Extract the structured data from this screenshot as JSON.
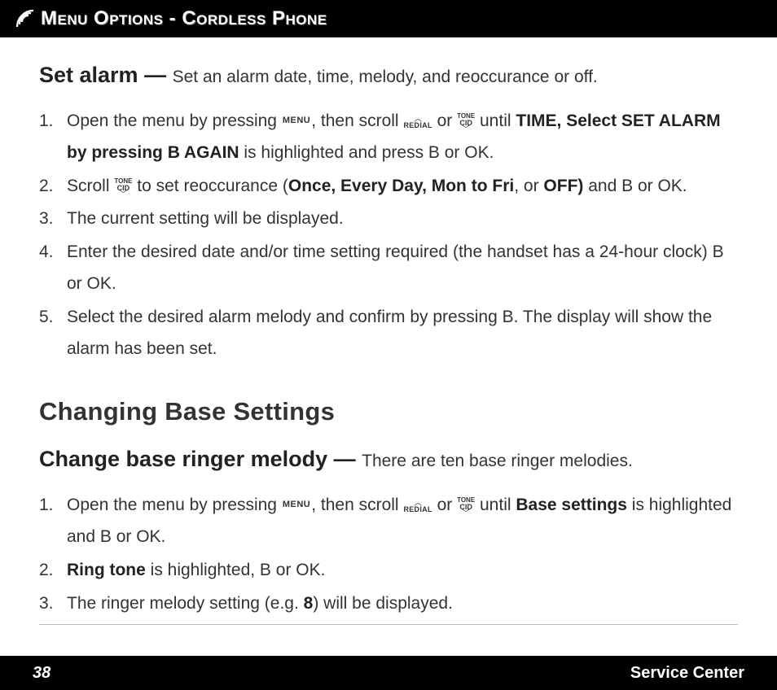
{
  "header": {
    "title": "Menu Options - Cordless Phone"
  },
  "icons": {
    "menu": "MENU",
    "redial": "REDIAL",
    "tone": "TONE",
    "cid": "CID"
  },
  "set_alarm": {
    "heading": "Set alarm",
    "dash": " — ",
    "desc": "Set an alarm date, time, melody, and reoccurance or off.",
    "steps": [
      {
        "n": "1.",
        "pre": "Open the menu by pressing ",
        "mid1": ", then scroll ",
        "mid2": " or ",
        "mid3": " until ",
        "bold1": "TIME, Select SET ALARM by pressing B AGAIN",
        "post": " is highlighted and press B or OK."
      },
      {
        "n": "2.",
        "pre": "Scroll ",
        "mid1": " to set reoccurance (",
        "bold1": "Once, Every Day, Mon to Fri",
        "mid2": ", or ",
        "bold2": "OFF)",
        "post": " and B or OK."
      },
      {
        "n": "3.",
        "text": "The current setting will be displayed."
      },
      {
        "n": "4.",
        "text": "Enter the desired date and/or time setting required (the handset has a 24-hour clock) B or OK."
      },
      {
        "n": "5.",
        "text": "Select the desired alarm melody and confirm by pressing B. The display will show the alarm has been set."
      }
    ]
  },
  "changing_base": {
    "h2": "Changing Base Settings",
    "subhead": "Change base ringer melody",
    "dash": " — ",
    "desc": "There are ten base ringer melodies.",
    "steps": [
      {
        "n": "1.",
        "pre": "Open the menu by pressing ",
        "mid1": ", then scroll ",
        "mid2": " or ",
        "mid3": " until ",
        "bold1": "Base settings",
        "post": " is highlighted and B or OK."
      },
      {
        "n": "2.",
        "bold1": "Ring tone",
        "post": " is highlighted, B or OK."
      },
      {
        "n": "3.",
        "pre": "The ringer melody setting (e.g. ",
        "bold1": "8",
        "post": ") will be displayed."
      }
    ]
  },
  "footer": {
    "page": "38",
    "service": "Service Center"
  }
}
